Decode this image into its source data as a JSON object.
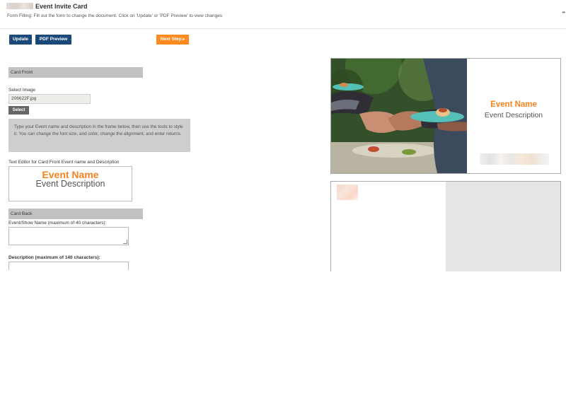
{
  "header": {
    "title": "Event Invite Card",
    "subtitle": "Form Filling: Fill out the form to change the document. Click on 'Update' or 'PDF Preview' to view changes",
    "more_icon": "ellipsis-icon"
  },
  "toolbar": {
    "update_label": "Update",
    "pdf_preview_label": "PDF Preview",
    "next_step_label": "Next Step"
  },
  "card_front": {
    "section_title": "Card Front",
    "select_image_label": "Select Image",
    "file_value": "206622F.jpg",
    "select_button_label": "Select",
    "info_text": "Type your Event name and description in the frame below, then use the tools to style it. You can change the font size, and color, change the alignment, and enter returns.",
    "editor_label": "Text Editor for Card Front Event name and Description",
    "editor_event_name": "Event Name",
    "editor_event_description": "Event Description"
  },
  "card_back": {
    "section_title": "Card Back",
    "event_name_label": "Event/Show Name (maximum of 40 characters):",
    "event_name_value": "",
    "description_label": "Description (maximum of 140 characters):",
    "description_value": ""
  },
  "preview": {
    "front_event_name": "Event Name",
    "front_event_description": "Event Description"
  },
  "colors": {
    "accent_orange": "#f5821f",
    "button_blue": "#1b4a7a",
    "section_gray": "#c2c2c2"
  }
}
